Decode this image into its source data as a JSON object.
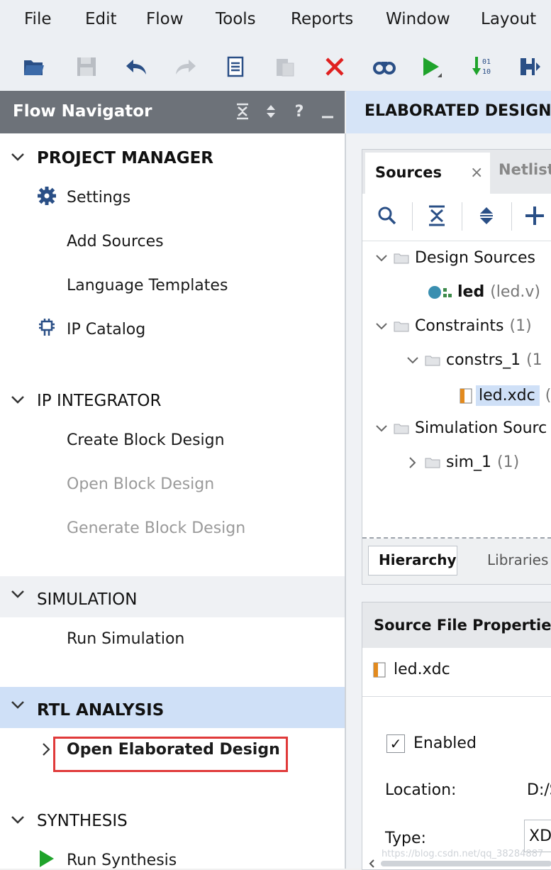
{
  "menu": [
    "File",
    "Edit",
    "Flow",
    "Tools",
    "Reports",
    "Window",
    "Layout"
  ],
  "toolbar": {
    "icons": [
      "open-folder-icon",
      "save-icon",
      "undo-icon",
      "redo-icon",
      "copy-icon",
      "paste-icon",
      "delete-icon",
      "find-icon",
      "run-icon",
      "sort-icon",
      "save-layout-icon"
    ]
  },
  "flow_navigator": {
    "title": "Flow Navigator",
    "header_icons": [
      "collapse-all-icon",
      "expand-all-icon",
      "help-icon",
      "minimize-icon"
    ],
    "help_glyph": "?",
    "sections": [
      {
        "title": "PROJECT MANAGER",
        "items": [
          "Settings",
          "Add Sources",
          "Language Templates",
          "IP Catalog"
        ]
      },
      {
        "title": "IP INTEGRATOR",
        "items": [
          "Create Block Design",
          "Open Block Design",
          "Generate Block Design"
        ]
      },
      {
        "title": "SIMULATION",
        "items": [
          "Run Simulation"
        ]
      },
      {
        "title": "RTL ANALYSIS",
        "items": [
          "Open Elaborated Design"
        ]
      },
      {
        "title": "SYNTHESIS",
        "items": [
          "Run Synthesis"
        ]
      }
    ]
  },
  "elaborated": {
    "title": "ELABORATED DESIGN -"
  },
  "sources_panel": {
    "tab_active": "Sources",
    "tab_close": "×",
    "tab_other": "Netlist",
    "tree": {
      "design_sources": "Design Sources",
      "led_name": "led",
      "led_file": "(led.v)",
      "constraints": "Constraints",
      "constraints_count": "(1)",
      "constrs_1": "constrs_1",
      "constrs_1_count": "(1",
      "led_xdc": "led.xdc",
      "led_xdc_suffix": "(",
      "simulation_sources": "Simulation Sourc",
      "sim_1": "sim_1",
      "sim_1_count": "(1)"
    },
    "bottom_tab_active": "Hierarchy",
    "bottom_tab_other": "Libraries"
  },
  "properties": {
    "title": "Source File Properties",
    "file": "led.xdc",
    "enabled_check": "✓",
    "enabled_label": "Enabled",
    "location_label": "Location:",
    "location_value": "D:/S",
    "type_label": "Type:",
    "type_value": "XD"
  },
  "watermark": "https://blog.csdn.net/qq_38284887",
  "colors": {
    "nav_header": "#6d7279",
    "selected": "#cfe0f7",
    "highlight_box": "#e03a3a",
    "run_green": "#1fa32b",
    "delete_red": "#e02020"
  }
}
